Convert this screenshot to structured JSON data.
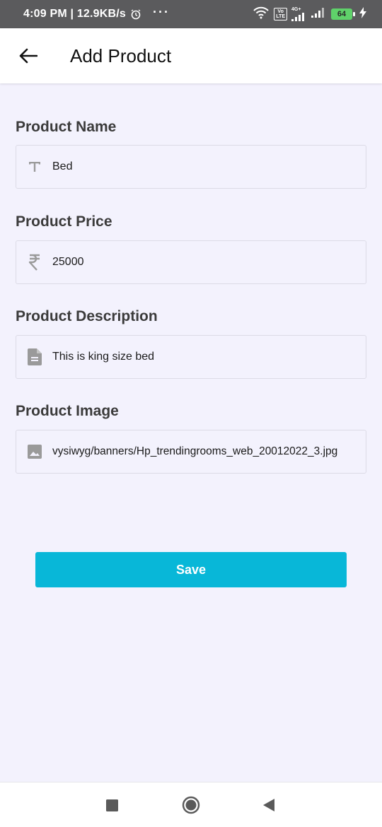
{
  "status_bar": {
    "time": "4:09 PM | 12.9KB/s",
    "dots": "···",
    "volte": "Vo\nLTE",
    "network": "4G+",
    "battery": "64"
  },
  "app_bar": {
    "title": "Add Product"
  },
  "form": {
    "name": {
      "label": "Product Name",
      "value": "Bed",
      "icon": "text-t-icon"
    },
    "price": {
      "label": "Product Price",
      "value": "25000",
      "icon": "rupee-icon"
    },
    "description": {
      "label": "Product Description",
      "value": "This is king size bed",
      "icon": "document-icon"
    },
    "image": {
      "label": "Product Image",
      "value": "vysiwyg/banners/Hp_trendingrooms_web_20012022_3.jpg",
      "icon": "image-icon"
    }
  },
  "save_label": "Save",
  "colors": {
    "accent": "#08b7d8",
    "background": "#f3f2fd",
    "status_bar": "#5b5b5d",
    "battery": "#5fd16a"
  }
}
